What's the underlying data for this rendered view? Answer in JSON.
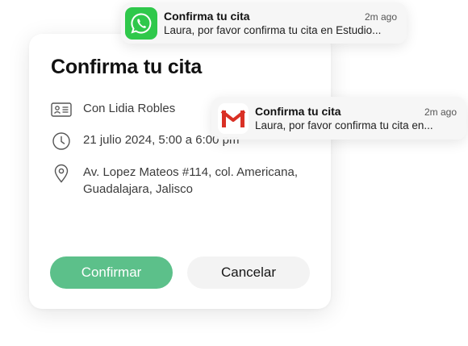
{
  "card": {
    "title": "Confirma tu cita",
    "person": "Con Lidia Robles",
    "datetime": "21 julio 2024, 5:00 a 6:00 pm",
    "address": "Av. Lopez Mateos #114, col. Americana, Guadalajara, Jalisco",
    "confirm_label": "Confirmar",
    "cancel_label": "Cancelar"
  },
  "notifications": [
    {
      "app": "whatsapp-icon",
      "title": "Confirma tu cita",
      "time": "2m ago",
      "text": "Laura, por favor confirma tu cita en Estudio..."
    },
    {
      "app": "gmail-icon",
      "title": "Confirma tu cita",
      "time": "2m ago",
      "text": "Laura, por favor confirma tu cita en..."
    }
  ],
  "colors": {
    "accent_green": "#5cc08a",
    "whatsapp_green": "#2fc84b",
    "gmail_red": "#d93025"
  }
}
